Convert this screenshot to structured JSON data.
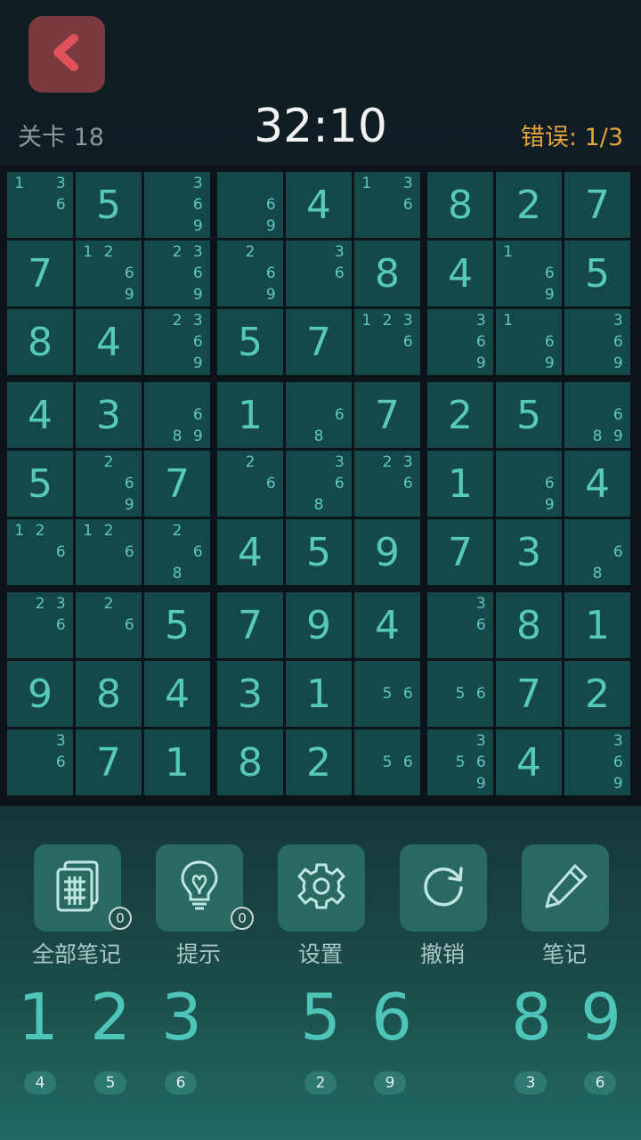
{
  "header": {
    "level_label": "关卡 18",
    "timer": "32:10",
    "errors_label": "错误:",
    "errors_value": "1/3",
    "back_icon": "chevron-left-icon"
  },
  "colors": {
    "background": "#112229",
    "cell": "#14484b",
    "digit": "#57c9bb",
    "back_button": "#7a3a3d",
    "errors": "#e6a23c"
  },
  "board": [
    [
      {
        "n": [
          1,
          3,
          6
        ]
      },
      {
        "v": 5
      },
      {
        "n": [
          3,
          6,
          9
        ]
      },
      {
        "n": [
          6,
          9
        ]
      },
      {
        "v": 4
      },
      {
        "n": [
          1,
          3,
          6
        ]
      },
      {
        "v": 8
      },
      {
        "v": 2
      },
      {
        "v": 7
      }
    ],
    [
      {
        "v": 7
      },
      {
        "n": [
          1,
          2,
          6,
          9
        ]
      },
      {
        "n": [
          2,
          3,
          6,
          9
        ]
      },
      {
        "n": [
          2,
          6,
          9
        ]
      },
      {
        "n": [
          3,
          6
        ]
      },
      {
        "v": 8
      },
      {
        "v": 4
      },
      {
        "n": [
          1,
          6,
          9
        ]
      },
      {
        "v": 5
      }
    ],
    [
      {
        "v": 8
      },
      {
        "v": 4
      },
      {
        "n": [
          2,
          3,
          6,
          9
        ]
      },
      {
        "v": 5
      },
      {
        "v": 7
      },
      {
        "n": [
          1,
          2,
          3,
          6
        ]
      },
      {
        "n": [
          3,
          6,
          9
        ]
      },
      {
        "n": [
          1,
          6,
          9
        ]
      },
      {
        "n": [
          3,
          6,
          9
        ]
      }
    ],
    [
      {
        "v": 4
      },
      {
        "v": 3
      },
      {
        "n": [
          6,
          8,
          9
        ]
      },
      {
        "v": 1
      },
      {
        "n": [
          6,
          8
        ]
      },
      {
        "v": 7
      },
      {
        "v": 2
      },
      {
        "v": 5
      },
      {
        "n": [
          6,
          8,
          9
        ]
      }
    ],
    [
      {
        "v": 5
      },
      {
        "n": [
          2,
          6,
          9
        ]
      },
      {
        "v": 7
      },
      {
        "n": [
          2,
          6
        ]
      },
      {
        "n": [
          3,
          6,
          8
        ]
      },
      {
        "n": [
          2,
          3,
          6
        ]
      },
      {
        "v": 1
      },
      {
        "n": [
          6,
          9
        ]
      },
      {
        "v": 4
      }
    ],
    [
      {
        "n": [
          1,
          2,
          6
        ]
      },
      {
        "n": [
          1,
          2,
          6
        ]
      },
      {
        "n": [
          2,
          6,
          8
        ]
      },
      {
        "v": 4
      },
      {
        "v": 5
      },
      {
        "v": 9
      },
      {
        "v": 7
      },
      {
        "v": 3
      },
      {
        "n": [
          6,
          8
        ]
      }
    ],
    [
      {
        "n": [
          2,
          3,
          6
        ]
      },
      {
        "n": [
          2,
          6
        ]
      },
      {
        "v": 5
      },
      {
        "v": 7
      },
      {
        "v": 9
      },
      {
        "v": 4
      },
      {
        "n": [
          3,
          6
        ]
      },
      {
        "v": 8
      },
      {
        "v": 1
      }
    ],
    [
      {
        "v": 9
      },
      {
        "v": 8
      },
      {
        "v": 4
      },
      {
        "v": 3
      },
      {
        "v": 1
      },
      {
        "n": [
          5,
          6
        ]
      },
      {
        "n": [
          5,
          6
        ]
      },
      {
        "v": 7
      },
      {
        "v": 2
      }
    ],
    [
      {
        "n": [
          3,
          6
        ]
      },
      {
        "v": 7
      },
      {
        "v": 1
      },
      {
        "v": 8
      },
      {
        "v": 2
      },
      {
        "n": [
          5,
          6
        ]
      },
      {
        "n": [
          3,
          5,
          6,
          9
        ]
      },
      {
        "v": 4
      },
      {
        "n": [
          3,
          6,
          9
        ]
      }
    ]
  ],
  "tools": [
    {
      "name": "notes-all",
      "label": "全部笔记",
      "icon": "notes-grid-icon",
      "badge": "0"
    },
    {
      "name": "hint",
      "label": "提示",
      "icon": "lightbulb-icon",
      "badge": "0"
    },
    {
      "name": "settings",
      "label": "设置",
      "icon": "gear-icon",
      "badge": null
    },
    {
      "name": "undo",
      "label": "撤销",
      "icon": "undo-icon",
      "badge": null
    },
    {
      "name": "notes",
      "label": "笔记",
      "icon": "pencil-icon",
      "badge": null
    }
  ],
  "numpad": [
    {
      "digit": "1",
      "count": "4"
    },
    {
      "digit": "2",
      "count": "5"
    },
    {
      "digit": "3",
      "count": "6"
    },
    {
      "digit": "5",
      "count": "2"
    },
    {
      "digit": "6",
      "count": "9"
    },
    {
      "digit": "8",
      "count": "3"
    },
    {
      "digit": "9",
      "count": "6"
    }
  ]
}
